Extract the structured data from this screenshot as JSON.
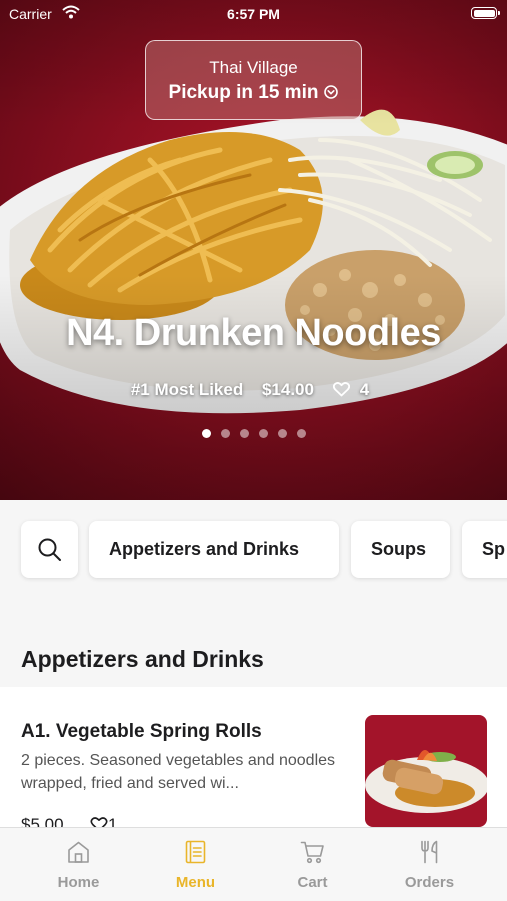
{
  "status_bar": {
    "carrier": "Carrier",
    "time": "6:57 PM"
  },
  "restaurant": {
    "name": "Thai Village",
    "pickup_eta": "Pickup in 15 min"
  },
  "featured": {
    "title": "N4. Drunken Noodles",
    "badge": "#1 Most Liked",
    "price": "$14.00",
    "likes": "4",
    "carousel_count": 6,
    "carousel_active": 0
  },
  "categories": [
    {
      "label": "Appetizers and Drinks"
    },
    {
      "label": "Soups"
    },
    {
      "label": "Sp"
    }
  ],
  "section": {
    "title": "Appetizers and Drinks"
  },
  "items": [
    {
      "name": "A1. Vegetable Spring Rolls",
      "description": "2 pieces. Seasoned vegetables and noodles wrapped, fried and served wi...",
      "price": "$5.00",
      "likes": "1"
    }
  ],
  "tabs": [
    {
      "label": "Home",
      "icon": "home-icon"
    },
    {
      "label": "Menu",
      "icon": "menu-book-icon",
      "active": true
    },
    {
      "label": "Cart",
      "icon": "cart-icon"
    },
    {
      "label": "Orders",
      "icon": "fork-knife-icon"
    }
  ],
  "colors": {
    "accent": "#e9b52a",
    "hero_bg": "#8c0f20",
    "tab_inactive": "#9a9a9a"
  }
}
